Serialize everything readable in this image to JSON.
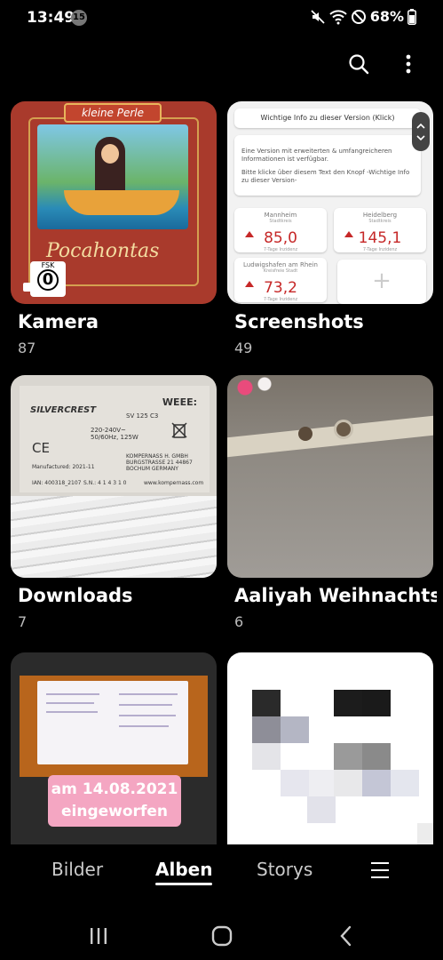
{
  "status_bar": {
    "time": "13:49",
    "notification_count": "15",
    "battery": "68%"
  },
  "toolbar": {
    "search_icon": "search-icon",
    "more_icon": "more-options-icon"
  },
  "albums": [
    {
      "name": "Kamera",
      "count": "87"
    },
    {
      "name": "Screenshots",
      "count": "49"
    },
    {
      "name": "Downloads",
      "count": "7"
    },
    {
      "name": "Aaliyah Weihnachts...",
      "count": "6"
    },
    {
      "name": "",
      "count": ""
    },
    {
      "name": "",
      "count": ""
    }
  ],
  "thumbs": {
    "kamera": {
      "banner": "kleine Perle",
      "title": "Pocahontas",
      "fsk_label": "FSK",
      "fsk_value": "0"
    },
    "screenshots": {
      "button": "Wichtige Info zu dieser Version (Klick)",
      "info_1": "Eine Version mit erweiterten & umfangreicheren Informationen ist verfügbar.",
      "info_2": "Bitte klicke über diesem Text den Knopf -Wichtige Info zu dieser Version-",
      "stats": [
        {
          "city": "Mannheim",
          "kind": "Stadtkreis",
          "value": "85,0",
          "sub": "7-Tage Inzidenz"
        },
        {
          "city": "Heidelberg",
          "kind": "Stadtkreis",
          "value": "145,1",
          "sub": "7-Tage Inzidenz"
        },
        {
          "city": "Ludwigshafen am Rhein",
          "kind": "Kreisfreie Stadt",
          "value": "73,2",
          "sub": "7-Tage Inzidenz"
        }
      ],
      "plus": "+"
    },
    "downloads": {
      "brand": "SILVERCREST",
      "weee": "WEEE:",
      "model": "SV 125 C3",
      "spec": "220-240V~ 50/60Hz, 125W",
      "maker": "KOMPERNASS H. GMBH BURGSTRASSE 21 44867 BOCHUM GERMANY",
      "url": "www.kompernass.com",
      "serial": "S.N.: 4 1 4 3 1 0",
      "ian": "IAN: 400318_2107",
      "manufactured": "Manufactured: 2021-11"
    },
    "card": {
      "sticker_line1": "am 14.08.2021",
      "sticker_line2": "eingeworfen"
    }
  },
  "tabs": [
    {
      "label": "Bilder",
      "active": false
    },
    {
      "label": "Alben",
      "active": true
    },
    {
      "label": "Storys",
      "active": false
    }
  ],
  "colors": {
    "background": "#000000",
    "accent_red": "#c62828",
    "sticker_pink": "#f4a6c2"
  }
}
